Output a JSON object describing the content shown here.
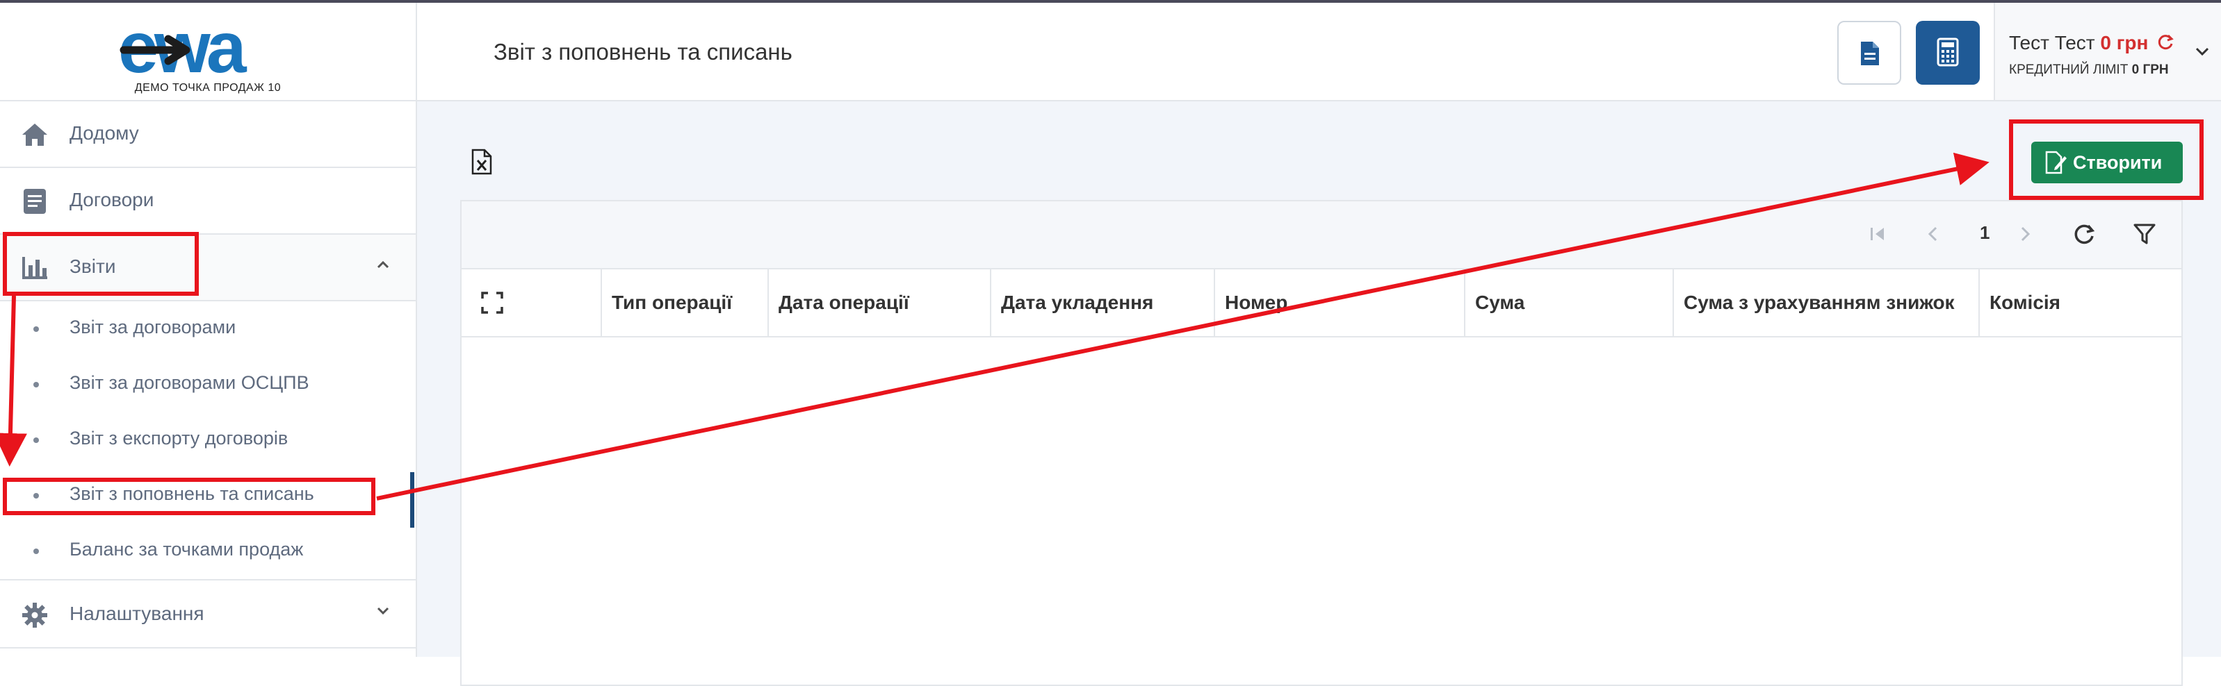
{
  "logo": {
    "text": "ewa",
    "subtitle": "ДЕМО ТОЧКА ПРОДАЖ 10",
    "colors": {
      "brand_blue": "#1b75bc",
      "brand_dark": "#1c1c1c"
    }
  },
  "sidebar": {
    "items": [
      {
        "label": "Додому",
        "icon": "home-icon"
      },
      {
        "label": "Договори",
        "icon": "document-icon"
      },
      {
        "label": "Звіти",
        "icon": "bar-chart-icon",
        "expanded": true
      },
      {
        "label": "Налаштування",
        "icon": "gear-icon",
        "expanded": false
      }
    ],
    "reports_sub": [
      {
        "label": "Звіт за договорами"
      },
      {
        "label": "Звіт за договорами ОСЦПВ"
      },
      {
        "label": "Звіт з експорту договорів"
      },
      {
        "label": "Звіт з поповнень та списань",
        "active": true
      },
      {
        "label": "Баланс за точками продаж"
      }
    ]
  },
  "header": {
    "title": "Звіт з поповнень та списань",
    "buttons": [
      {
        "icon": "file-document-icon"
      },
      {
        "icon": "calculator-icon"
      }
    ],
    "user": {
      "name": "Тест Тест",
      "balance": "0 грн",
      "credit_label": "КРЕДИТНИЙ ЛІМІТ",
      "credit_value": "0 ГРН"
    }
  },
  "main": {
    "create_button": "Створити",
    "pagination": {
      "page": "1"
    },
    "columns": [
      "Тип операції",
      "Дата операції",
      "Дата укладення",
      "Номер",
      "Сума",
      "Сума з урахуванням знижок",
      "Комісія"
    ],
    "rows": []
  },
  "colors": {
    "accent_green": "#198754",
    "annotation_red": "#e8141c",
    "header_button_blue": "#1f5a96",
    "active_bar": "#1c4a7a"
  }
}
